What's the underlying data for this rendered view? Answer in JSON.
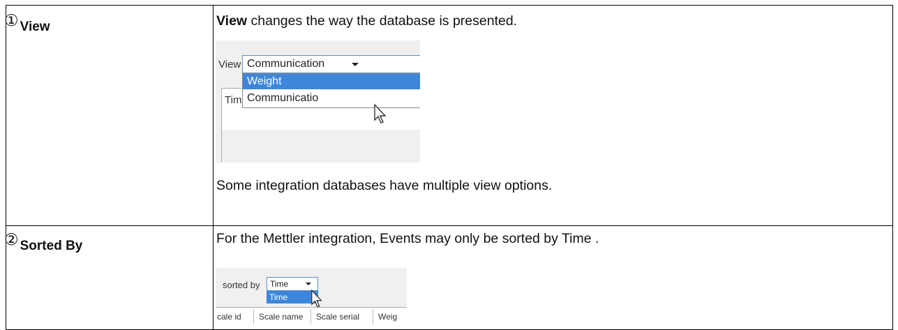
{
  "rows": [
    {
      "number_glyph": "①",
      "label": "View",
      "text_bold": "View",
      "text_rest": " changes the way the database is presented.",
      "note": "Some integration databases have multiple view options.",
      "screenshot": {
        "view_label": "View",
        "selected_value": "Communication",
        "options": [
          "Weight",
          "Communicatio"
        ],
        "column_header": "Time"
      }
    },
    {
      "number_glyph": "②",
      "label": "Sorted By",
      "text": "For the Mettler integration, Events may only be sorted by Time .",
      "screenshot": {
        "sort_label": "sorted by",
        "selected_value": "Time",
        "options": [
          "Time"
        ],
        "columns": [
          "cale id",
          "Scale name",
          "Scale serial",
          "Weig"
        ]
      }
    }
  ],
  "colors": {
    "selection": "#3d86d9",
    "border": "#000000",
    "combo_border": "#5a8fc8"
  }
}
